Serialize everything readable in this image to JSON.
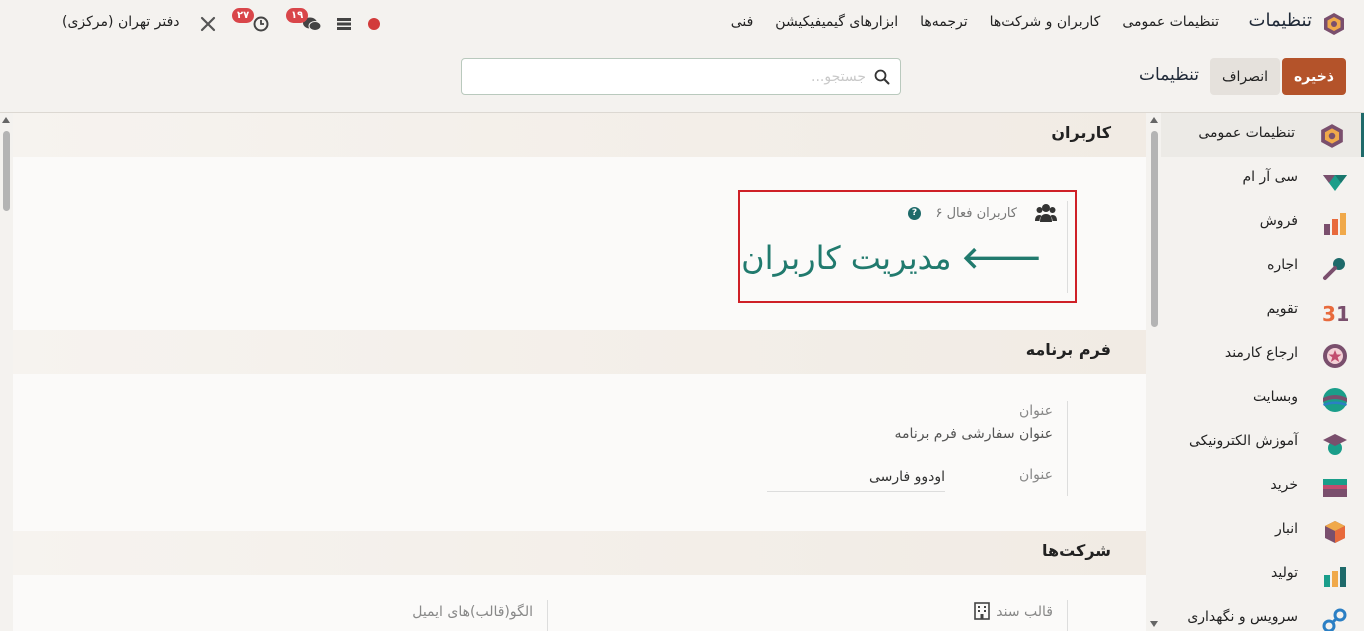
{
  "navbar": {
    "app_title": "تنظیمات",
    "menu": [
      "تنظیمات عمومی",
      "کاربران و شرکت‌ها",
      "ترجمه‌ها",
      "ابزارهای گیمیفیکیشن",
      "فنی"
    ],
    "messages_count": "۱۹",
    "activities_count": "۲۷",
    "company": "دفتر تهران (مرکزی)"
  },
  "control_panel": {
    "save_label": "ذخیره",
    "cancel_label": "انصراف",
    "breadcrumb": "تنظیمات",
    "search_placeholder": "جستجو..."
  },
  "sidebar": {
    "items": [
      {
        "label": "تنظیمات عمومی",
        "icon": "settings-icon",
        "active": true
      },
      {
        "label": "سی آر ام",
        "icon": "crm-icon"
      },
      {
        "label": "فروش",
        "icon": "sales-icon"
      },
      {
        "label": "اجاره",
        "icon": "rental-icon"
      },
      {
        "label": "تقویم",
        "icon": "calendar-icon"
      },
      {
        "label": "ارجاع کارمند",
        "icon": "referral-icon"
      },
      {
        "label": "وبسایت",
        "icon": "website-icon"
      },
      {
        "label": "آموزش الکترونیکی",
        "icon": "elearning-icon"
      },
      {
        "label": "خرید",
        "icon": "purchase-icon"
      },
      {
        "label": "انبار",
        "icon": "inventory-icon"
      },
      {
        "label": "تولید",
        "icon": "manufacturing-icon"
      },
      {
        "label": "سرویس و نگهداری",
        "icon": "maintenance-icon"
      }
    ]
  },
  "sections": {
    "users": {
      "title": "کاربران",
      "active_users": "۶ کاربران فعال",
      "manage_link": "مدیریت کاربران"
    },
    "app_form": {
      "title": "فرم برنامه",
      "field1_label": "عنوان",
      "field1_desc": "عنوان سفارشی فرم برنامه",
      "field2_label": "عنوان",
      "field2_value": "اودوو فارسی"
    },
    "companies": {
      "title": "شرکت‌ها",
      "doc_layout_label": "قالب سند",
      "email_templates_label": "الگو(قالب)های ایمیل"
    }
  },
  "colors": {
    "accent": "#b4532a",
    "link": "#217a6e",
    "highlight": "#cf2027"
  }
}
